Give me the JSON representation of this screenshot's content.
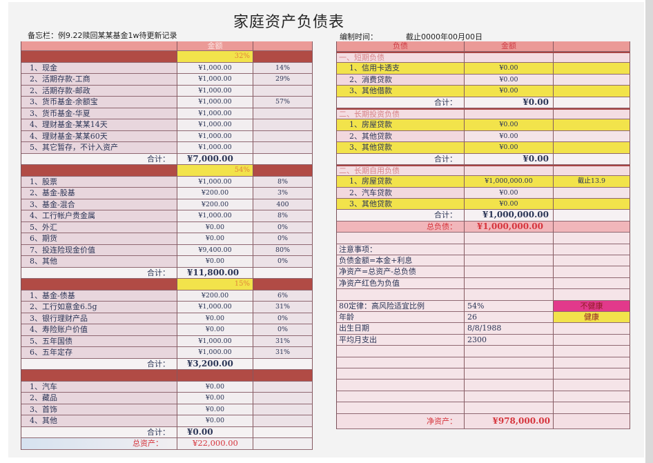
{
  "colors": {
    "header_salmon": "#eb9a97",
    "section_dark_red": "#b14b45",
    "highlight_yellow": "#f2e34b",
    "negative_red": "#d6343c",
    "warning_magenta": "#e2398b"
  },
  "page": {
    "title": "家庭资产负债表",
    "memo": "备忘栏：例9.22赎回某某基金1w待更新记录",
    "prepared_label": "编制时间：",
    "prepared_value": "截止0000年00月00日"
  },
  "assets": {
    "amount_header": "金额",
    "sections": [
      {
        "share": "32%",
        "rows": [
          {
            "label": "1、现金",
            "amount": "¥1,000.00",
            "pct": "14%"
          },
          {
            "label": "2、活期存款-工商",
            "amount": "¥1,000.00",
            "pct": "29%"
          },
          {
            "label": "2、活期存款-邮政",
            "amount": "¥1,000.00"
          },
          {
            "label": "3、货币基金-余额宝",
            "amount": "¥1,000.00",
            "pct": "57%"
          },
          {
            "label": "3、货币基金-华夏",
            "amount": "¥1,000.00"
          },
          {
            "label": "4、理财基金-某某14天",
            "amount": "¥1,000.00"
          },
          {
            "label": "4、理财基金-某某60天",
            "amount": "¥1,000.00"
          },
          {
            "label": "5、其它暂存，不计入资产",
            "amount": "¥1,000.00"
          }
        ],
        "total_label": "合计：",
        "total": "¥7,000.00"
      },
      {
        "share": "54%",
        "rows": [
          {
            "label": "1、股票",
            "amount": "¥1,000.00",
            "pct": "8%"
          },
          {
            "label": "2、基金-股基",
            "amount": "¥200.00",
            "pct": "3%"
          },
          {
            "label": "3、基金-混合",
            "amount": "¥200.00",
            "pct": "400"
          },
          {
            "label": "4、工行帐户贵金属",
            "amount": "¥1,000.00",
            "pct": "8%"
          },
          {
            "label": "5、外汇",
            "amount": "¥0.00",
            "pct": "0%"
          },
          {
            "label": "6、期货",
            "amount": "¥0.00",
            "pct": "0%"
          },
          {
            "label": "7、投连险现金价值",
            "amount": "¥9,400.00",
            "pct": "80%"
          },
          {
            "label": "8、其他",
            "amount": "¥0.00",
            "pct": "0%"
          }
        ],
        "total_label": "合计：",
        "total": "¥11,800.00"
      },
      {
        "share": "15%",
        "rows": [
          {
            "label": "1、基金-债基",
            "amount": "¥200.00",
            "pct": "6%"
          },
          {
            "label": "2、工行如意金6.5g",
            "amount": "¥1,000.00",
            "pct": "31%"
          },
          {
            "label": "3、银行理财产品",
            "amount": "¥0.00",
            "pct": "0%"
          },
          {
            "label": "4、寿险账户价值",
            "amount": "¥0.00",
            "pct": "0%"
          },
          {
            "label": "5、五年国债",
            "amount": "¥1,000.00",
            "pct": "31%"
          },
          {
            "label": "6、五年定存",
            "amount": "¥1,000.00",
            "pct": "31%"
          }
        ],
        "total_label": "合计：",
        "total": "¥3,200.00"
      },
      {
        "rows": [
          {
            "label": "1、汽车",
            "amount": "¥0.00"
          },
          {
            "label": "2、藏品",
            "amount": "¥0.00"
          },
          {
            "label": "3、首饰",
            "amount": "¥0.00"
          },
          {
            "label": "4、其他",
            "amount": "¥0.00"
          }
        ],
        "total_label": "合计：",
        "total": "¥0.00"
      }
    ],
    "grand_total_label": "总资产：",
    "grand_total": "¥22,000.00"
  },
  "liabilities": {
    "label_header": "负债",
    "amount_header": "金额",
    "groups": [
      {
        "title": "一、短期负债",
        "rows": [
          {
            "label": "1、信用卡透支",
            "amount": "¥0.00"
          },
          {
            "label": "2、消费贷款",
            "amount": "¥0.00"
          },
          {
            "label": "3、其他借款",
            "amount": "¥0.00"
          }
        ],
        "total_label": "合计：",
        "total": "¥0.00"
      },
      {
        "title": "二、长期投资负债",
        "rows": [
          {
            "label": "1、房屋贷款",
            "amount": "¥0.00"
          },
          {
            "label": "2、其他贷款",
            "amount": "¥0.00"
          },
          {
            "label": "3、其他贷款",
            "amount": "¥0.00"
          }
        ],
        "total_label": "合计：",
        "total": "¥0.00"
      },
      {
        "title": "二、长期自用负债",
        "rows": [
          {
            "label": "1、房屋贷款",
            "amount": "¥1,000,000.00",
            "note": "截止13.9"
          },
          {
            "label": "2、汽车贷款",
            "amount": "¥0.00"
          },
          {
            "label": "3、其他贷款",
            "amount": "¥0.00"
          }
        ],
        "total_label": "合计：",
        "total": "¥1,000,000.00"
      }
    ],
    "grand_total_label": "总负债：",
    "grand_total": "¥1,000,000.00"
  },
  "notes": {
    "heading": "注意事项：",
    "lines": [
      "负债金额=本金+利息",
      "净资产=总资产-总负债",
      "净资产红色为负值"
    ],
    "stats": [
      {
        "label": "80定律：高风险适宜比例",
        "value": "54%",
        "status": "不健康",
        "status_color": "#e2398b"
      },
      {
        "label": "年龄",
        "value": "26",
        "status": "健康",
        "status_color": "#f2e34b"
      },
      {
        "label": "出生日期",
        "value": "8/8/1988"
      },
      {
        "label": "平均月支出",
        "value": "2300"
      }
    ]
  },
  "net_worth": {
    "label": "净资产：",
    "value": "¥978,000.00"
  }
}
